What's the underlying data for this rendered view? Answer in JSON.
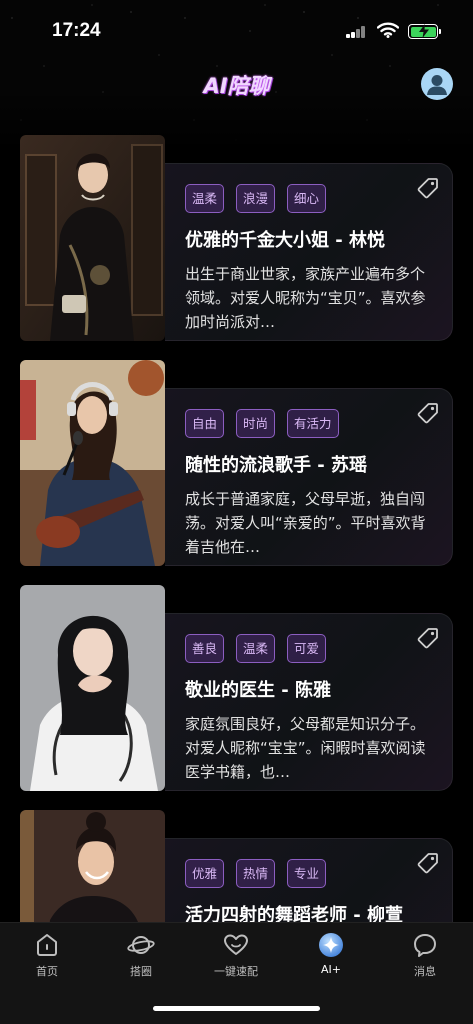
{
  "status_bar": {
    "time": "17:24"
  },
  "header": {
    "title": "AI陪聊"
  },
  "cards": [
    {
      "tags": [
        "温柔",
        "浪漫",
        "细心"
      ],
      "title": "优雅的千金大小姐 - 林悦",
      "description": "出生于商业世家，家族产业遍布多个领域。对爱人昵称为“宝贝”。喜欢参加时尚派对…"
    },
    {
      "tags": [
        "自由",
        "时尚",
        "有活力"
      ],
      "title": "随性的流浪歌手 - 苏瑶",
      "description": "成长于普通家庭，父母早逝，独自闯荡。对爱人叫“亲爱的”。平时喜欢背着吉他在…"
    },
    {
      "tags": [
        "善良",
        "温柔",
        "可爱"
      ],
      "title": "敬业的医生 - 陈雅",
      "description": "家庭氛围良好，父母都是知识分子。对爱人昵称“宝宝”。闲暇时喜欢阅读医学书籍，也…"
    },
    {
      "tags": [
        "优雅",
        "热情",
        "专业"
      ],
      "title": "活力四射的舞蹈老师 - 柳萱",
      "description": ""
    }
  ],
  "tab_bar": {
    "items": [
      {
        "label": "首页",
        "icon": "home-icon"
      },
      {
        "label": "搭圈",
        "icon": "planet-icon"
      },
      {
        "label": "一键速配",
        "icon": "match-icon"
      },
      {
        "label": "AI+",
        "icon": "ai-sparkle-icon",
        "active": true
      },
      {
        "label": "消息",
        "icon": "message-icon"
      }
    ]
  },
  "colors": {
    "accent_purple": "#8c5ec1",
    "chip_text": "#d9b8f5",
    "title_glow": "#d66bff",
    "avatar_bg": "#a9d6f5",
    "battery_green": "#3cd45b",
    "ai_icon_blue": "#6fb3ff"
  }
}
